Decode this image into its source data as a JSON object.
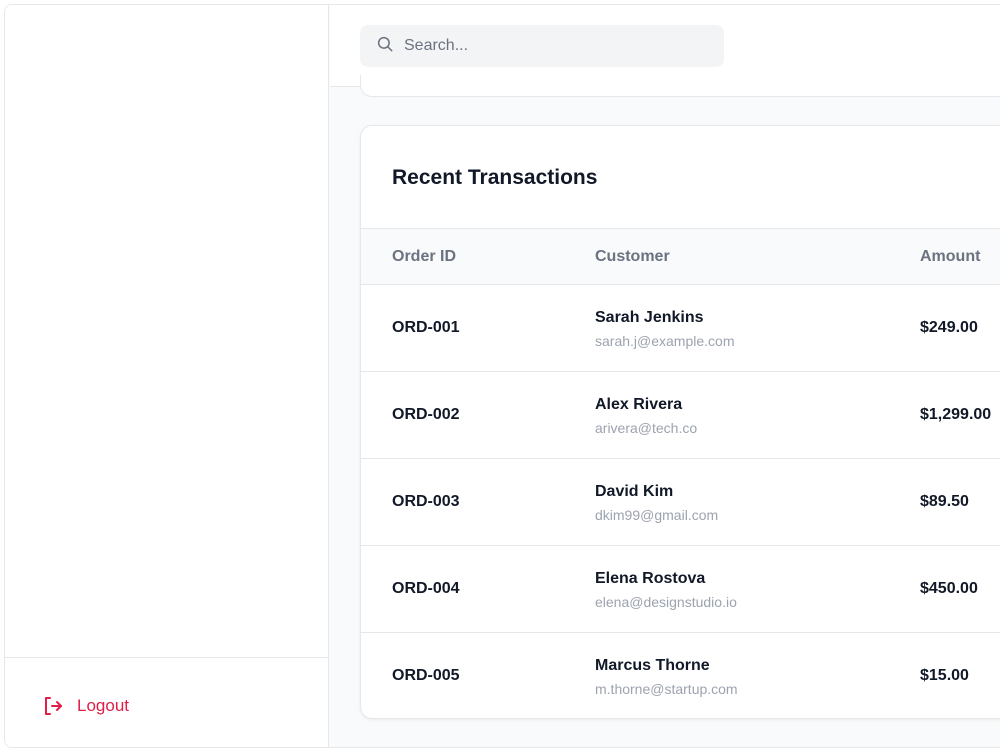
{
  "sidebar": {
    "logout_label": "Logout"
  },
  "search": {
    "placeholder": "Search..."
  },
  "transactions": {
    "title": "Recent Transactions",
    "columns": [
      "Order ID",
      "Customer",
      "Amount"
    ],
    "rows": [
      {
        "id": "ORD-001",
        "name": "Sarah Jenkins",
        "email": "sarah.j@example.com",
        "amount": "$249.00"
      },
      {
        "id": "ORD-002",
        "name": "Alex Rivera",
        "email": "arivera@tech.co",
        "amount": "$1,299.00"
      },
      {
        "id": "ORD-003",
        "name": "David Kim",
        "email": "dkim99@gmail.com",
        "amount": "$89.50"
      },
      {
        "id": "ORD-004",
        "name": "Elena Rostova",
        "email": "elena@designstudio.io",
        "amount": "$450.00"
      },
      {
        "id": "ORD-005",
        "name": "Marcus Thorne",
        "email": "m.thorne@startup.com",
        "amount": "$15.00"
      }
    ]
  },
  "colors": {
    "logout": "#e11d48",
    "border": "#e5e7eb",
    "muted_text": "#6b7280"
  },
  "icons": {
    "search": "search-icon",
    "logout": "logout-icon"
  }
}
